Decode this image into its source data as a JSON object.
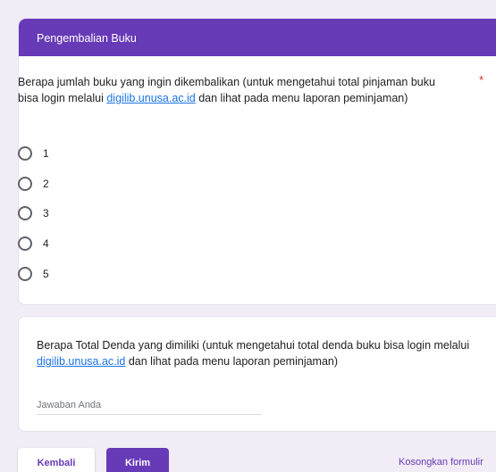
{
  "section": {
    "title": "Pengembalian Buku"
  },
  "question1": {
    "text_before": "Berapa jumlah buku yang ingin dikembalikan (untuk mengetahui total pinjaman buku bisa login melalui ",
    "link": "digilib.unusa.ac.id",
    "text_after": " dan lihat pada menu laporan peminjaman)",
    "required_mark": "*",
    "options": [
      "1",
      "2",
      "3",
      "4",
      "5"
    ]
  },
  "question2": {
    "text_before": "Berapa Total Denda yang dimiliki (untuk mengetahui total denda buku bisa login melalui ",
    "link": "digilib.unusa.ac.id",
    "text_after": " dan lihat pada menu laporan peminjaman)",
    "placeholder": "Jawaban Anda"
  },
  "footer": {
    "back_label": "Kembali",
    "submit_label": "Kirim",
    "clear_label": "Kosongkan formulir"
  },
  "colors": {
    "accent": "#673ab7",
    "link": "#1a73e8",
    "required": "#d93025",
    "background": "#f1ecf6"
  }
}
